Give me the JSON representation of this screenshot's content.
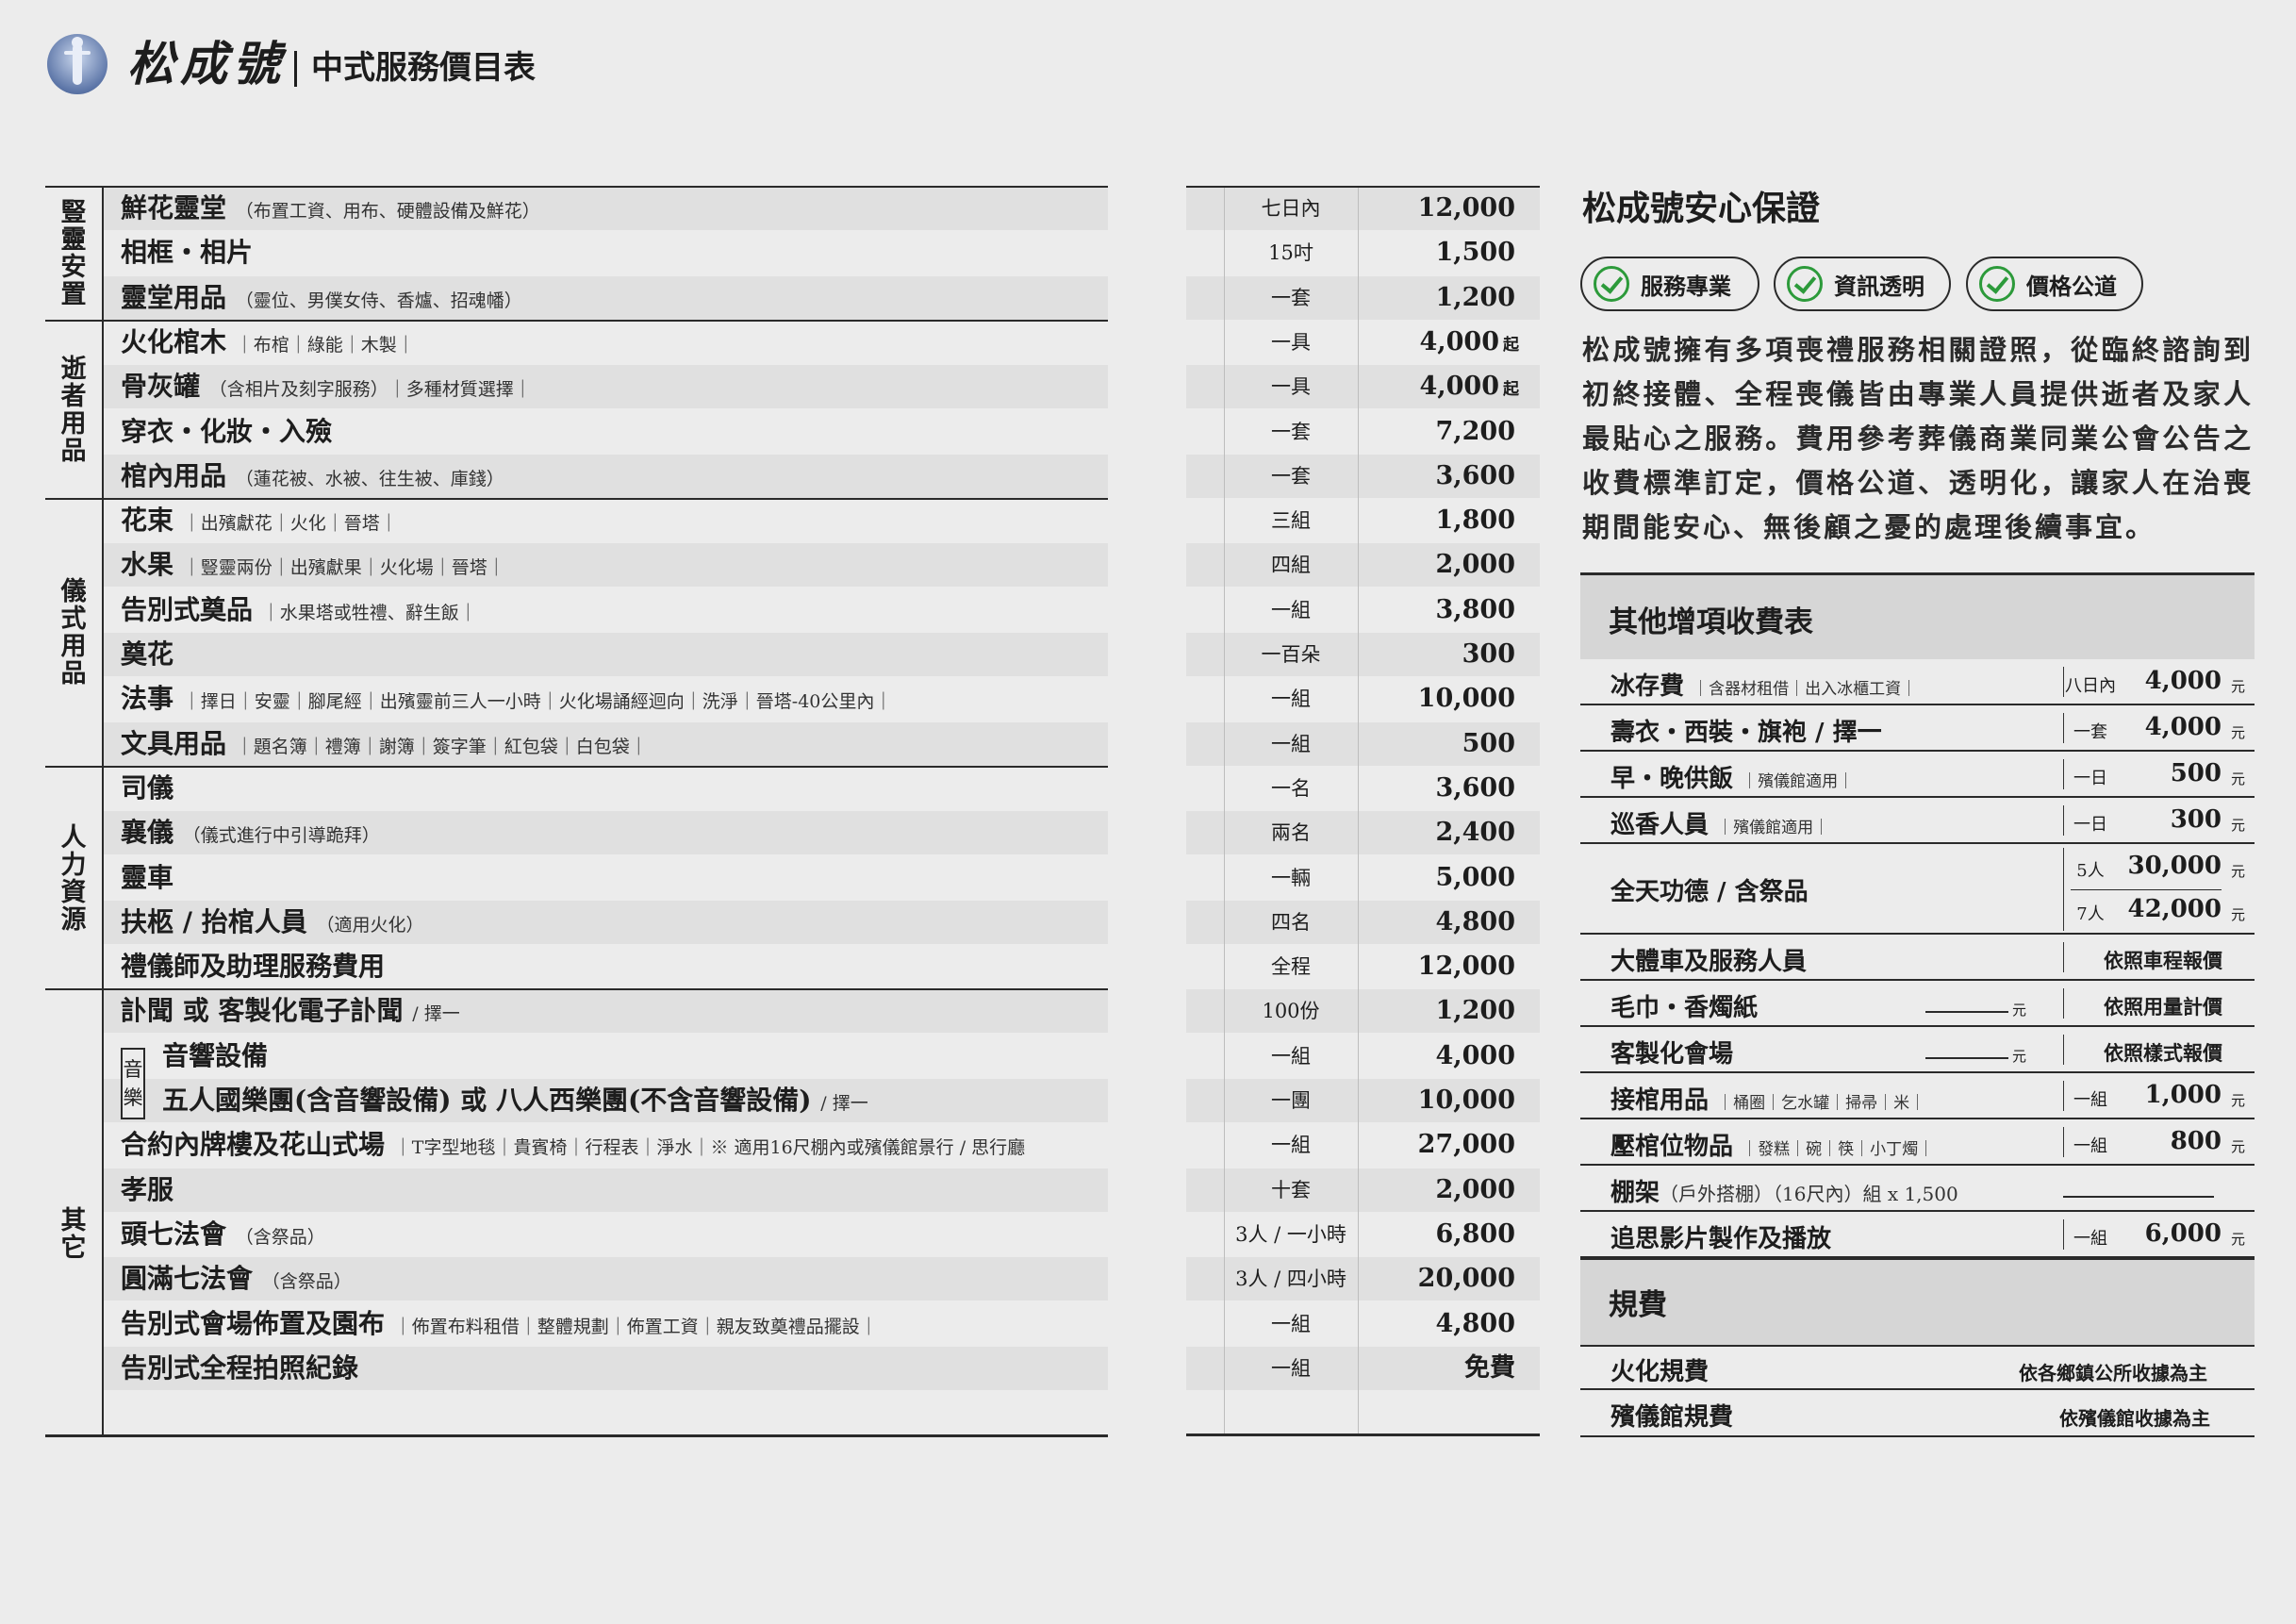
{
  "header": {
    "brand": "松成號",
    "subtitle": "中式服務價目表"
  },
  "categories": [
    {
      "label": "豎靈安置",
      "rows": 3
    },
    {
      "label": "逝者用品",
      "rows": 4
    },
    {
      "label": "儀式用品",
      "rows": 6
    },
    {
      "label": "人力資源",
      "rows": 5
    },
    {
      "label": "其它",
      "rows": 10
    }
  ],
  "items": [
    {
      "name": "鮮花靈堂",
      "note": "（布置工資、用布、硬體設備及鮮花）",
      "unit": "七日內",
      "price": "12,000",
      "suffix": ""
    },
    {
      "name": "相框・相片",
      "note": "",
      "unit": "15吋",
      "price": "1,500",
      "suffix": ""
    },
    {
      "name": "靈堂用品",
      "note": "（靈位、男僕女侍、香爐、招魂幡）",
      "unit": "一套",
      "price": "1,200",
      "suffix": ""
    },
    {
      "name": "火化棺木",
      "note": "｜布棺｜綠能｜木製｜",
      "unit": "一具",
      "price": "4,000",
      "suffix": "起"
    },
    {
      "name": "骨灰罐",
      "note": "（含相片及刻字服務）｜多種材質選擇｜",
      "unit": "一具",
      "price": "4,000",
      "suffix": "起"
    },
    {
      "name": "穿衣・化妝・入殮",
      "note": "",
      "unit": "一套",
      "price": "7,200",
      "suffix": ""
    },
    {
      "name": "棺內用品",
      "note": "（蓮花被、水被、往生被、庫錢）",
      "unit": "一套",
      "price": "3,600",
      "suffix": ""
    },
    {
      "name": "花束",
      "note": "｜出殯獻花｜火化｜晉塔｜",
      "unit": "三組",
      "price": "1,800",
      "suffix": ""
    },
    {
      "name": "水果",
      "note": "｜豎靈兩份｜出殯獻果｜火化場｜晉塔｜",
      "unit": "四組",
      "price": "2,000",
      "suffix": ""
    },
    {
      "name": "告別式奠品",
      "note": "｜水果塔或牲禮、辭生飯｜",
      "unit": "一組",
      "price": "3,800",
      "suffix": ""
    },
    {
      "name": "奠花",
      "note": "",
      "unit": "一百朵",
      "price": "300",
      "suffix": ""
    },
    {
      "name": "法事",
      "note": "｜擇日｜安靈｜腳尾經｜出殯靈前三人一小時｜火化場誦經迴向｜洗淨｜晉塔-40公里內｜",
      "unit": "一組",
      "price": "10,000",
      "suffix": ""
    },
    {
      "name": "文具用品",
      "note": "｜題名簿｜禮簿｜謝簿｜簽字筆｜紅包袋｜白包袋｜",
      "unit": "一組",
      "price": "500",
      "suffix": ""
    },
    {
      "name": "司儀",
      "note": "",
      "unit": "一名",
      "price": "3,600",
      "suffix": ""
    },
    {
      "name": "襄儀",
      "note": "（儀式進行中引導跪拜）",
      "unit": "兩名",
      "price": "2,400",
      "suffix": ""
    },
    {
      "name": "靈車",
      "note": "",
      "unit": "一輛",
      "price": "5,000",
      "suffix": ""
    },
    {
      "name": "扶柩 / 抬棺人員",
      "note": "（適用火化）",
      "unit": "四名",
      "price": "4,800",
      "suffix": ""
    },
    {
      "name": "禮儀師及助理服務費用",
      "note": "",
      "unit": "全程",
      "price": "12,000",
      "suffix": ""
    },
    {
      "name": "訃聞 或 客製化電子訃聞",
      "note": "/ 擇一",
      "unit": "100份",
      "price": "1,200",
      "suffix": ""
    },
    {
      "name": "音響設備",
      "note": "",
      "unit": "一組",
      "price": "4,000",
      "suffix": ""
    },
    {
      "name": "五人國樂團(含音響設備) 或 八人西樂團(不含音響設備)",
      "note": "/ 擇一",
      "unit": "一團",
      "price": "10,000",
      "suffix": ""
    },
    {
      "name": "合約內牌樓及花山式場",
      "note": "｜T字型地毯｜貴賓椅｜行程表｜淨水｜※ 適用16尺棚內或殯儀館景行 / 思行廳",
      "unit": "一組",
      "price": "27,000",
      "suffix": ""
    },
    {
      "name": "孝服",
      "note": "",
      "unit": "十套",
      "price": "2,000",
      "suffix": ""
    },
    {
      "name": "頭七法會",
      "note": "（含祭品）",
      "unit": "3人 / 一小時",
      "price": "6,800",
      "suffix": ""
    },
    {
      "name": "圓滿七法會",
      "note": "（含祭品）",
      "unit": "3人 / 四小時",
      "price": "20,000",
      "suffix": ""
    },
    {
      "name": "告別式會場佈置及園布",
      "note": "｜佈置布料租借｜整體規劃｜佈置工資｜親友致奠禮品擺設｜",
      "unit": "一組",
      "price": "4,800",
      "suffix": ""
    },
    {
      "name": "告別式全程拍照紀錄",
      "note": "",
      "unit": "一組",
      "price": "免費",
      "suffix": ""
    }
  ],
  "music_tag": "音樂",
  "guarantee": {
    "title": "松成號安心保證",
    "badges": [
      "服務專業",
      "資訊透明",
      "價格公道"
    ],
    "intro": "松成號擁有多項喪禮服務相關證照，從臨終諮詢到初終接體、全程喪儀皆由專業人員提供逝者及家人最貼心之服務。費用參考葬儀商業同業公會公告之收費標準訂定，價格公道、透明化，讓家人在治喪期間能安心、無後顧之憂的處理後續事宜。"
  },
  "extra": {
    "title": "其他增項收費表",
    "rows": [
      {
        "name": "冰存費",
        "note": "｜含器材租借｜出入冰櫃工資｜",
        "unit": "八日內",
        "price": "4,000",
        "yuan": "元"
      },
      {
        "name": "壽衣・西裝・旗袍 / 擇一",
        "note": "",
        "unit": "一套",
        "price": "4,000",
        "yuan": "元"
      },
      {
        "name": "早・晚供飯",
        "note": "｜殯儀館適用｜",
        "unit": "一日",
        "price": "500",
        "yuan": "元"
      },
      {
        "name": "巡香人員",
        "note": "｜殯儀館適用｜",
        "unit": "一日",
        "price": "300",
        "yuan": "元"
      }
    ],
    "merit": {
      "name": "全天功德 / 含祭品",
      "opts": [
        {
          "unit": "5人",
          "price": "30,000",
          "yuan": "元"
        },
        {
          "unit": "7人",
          "price": "42,000",
          "yuan": "元"
        }
      ]
    },
    "rows2": [
      {
        "name": "大體車及服務人員",
        "text": "依照車程報價"
      },
      {
        "name": "毛巾・香燭紙",
        "yuan": "元",
        "text": "依照用量計價"
      },
      {
        "name": "客製化會場",
        "yuan": "元",
        "text": "依照樣式報價"
      }
    ],
    "rows3": [
      {
        "name": "接棺用品",
        "note": "｜桶圈｜乞水罐｜掃帚｜米｜",
        "unit": "一組",
        "price": "1,000",
        "yuan": "元"
      },
      {
        "name": "壓棺位物品",
        "note": "｜發糕｜碗｜筷｜小丁燭｜",
        "unit": "一組",
        "price": "800",
        "yuan": "元"
      }
    ],
    "shed": {
      "name": "棚架",
      "note": "（戶外搭棚）（16尺內）組 x 1,500"
    },
    "video": {
      "name": "追思影片製作及播放",
      "unit": "一組",
      "price": "6,000",
      "yuan": "元"
    }
  },
  "fees": {
    "title": "規費",
    "rows": [
      {
        "name": "火化規費",
        "text": "依各鄉鎮公所收據為主"
      },
      {
        "name": "殯儀館規費",
        "text": "依殯儀館收據為主"
      }
    ]
  }
}
